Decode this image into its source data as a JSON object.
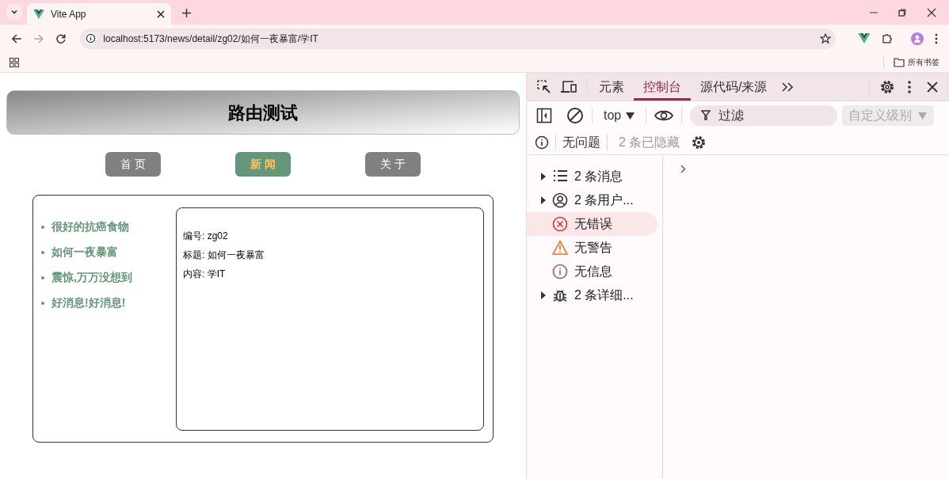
{
  "browser": {
    "tab_title": "Vite App",
    "url": "localhost:5173/news/detail/zg02/如何一夜暴富/学IT",
    "bookmarks_label": "所有书签"
  },
  "app": {
    "title": "路由测试",
    "nav": [
      {
        "label": "首 页",
        "selected": false
      },
      {
        "label": "新 闻",
        "selected": true
      },
      {
        "label": "关 于",
        "selected": false
      }
    ],
    "news_list": [
      "很好的抗癌食物",
      "如何一夜暴富",
      "震惊,万万没想到",
      "好消息!好消息!"
    ],
    "detail": [
      "编号: zg02",
      "标题: 如何一夜暴富",
      "内容: 学IT"
    ]
  },
  "devtools": {
    "tabs": [
      {
        "label": "元素",
        "selected": false
      },
      {
        "label": "控制台",
        "selected": true
      },
      {
        "label": "源代码/来源",
        "selected": false
      }
    ],
    "context": "top",
    "filter_placeholder": "过滤",
    "levels": "自定义级别",
    "issues": "无问题",
    "hidden": "2 条已隐藏",
    "sidebar": [
      {
        "kind": "messages",
        "label": "2 条消息",
        "expandable": true,
        "selected": false
      },
      {
        "kind": "user",
        "label": "2 条用户...",
        "expandable": true,
        "selected": false
      },
      {
        "kind": "error",
        "label": "无错误",
        "expandable": false,
        "selected": true
      },
      {
        "kind": "warning",
        "label": "无警告",
        "expandable": false,
        "selected": false
      },
      {
        "kind": "info",
        "label": "无信息",
        "expandable": false,
        "selected": false
      },
      {
        "kind": "verbose",
        "label": "2 条详细...",
        "expandable": true,
        "selected": false
      }
    ]
  }
}
